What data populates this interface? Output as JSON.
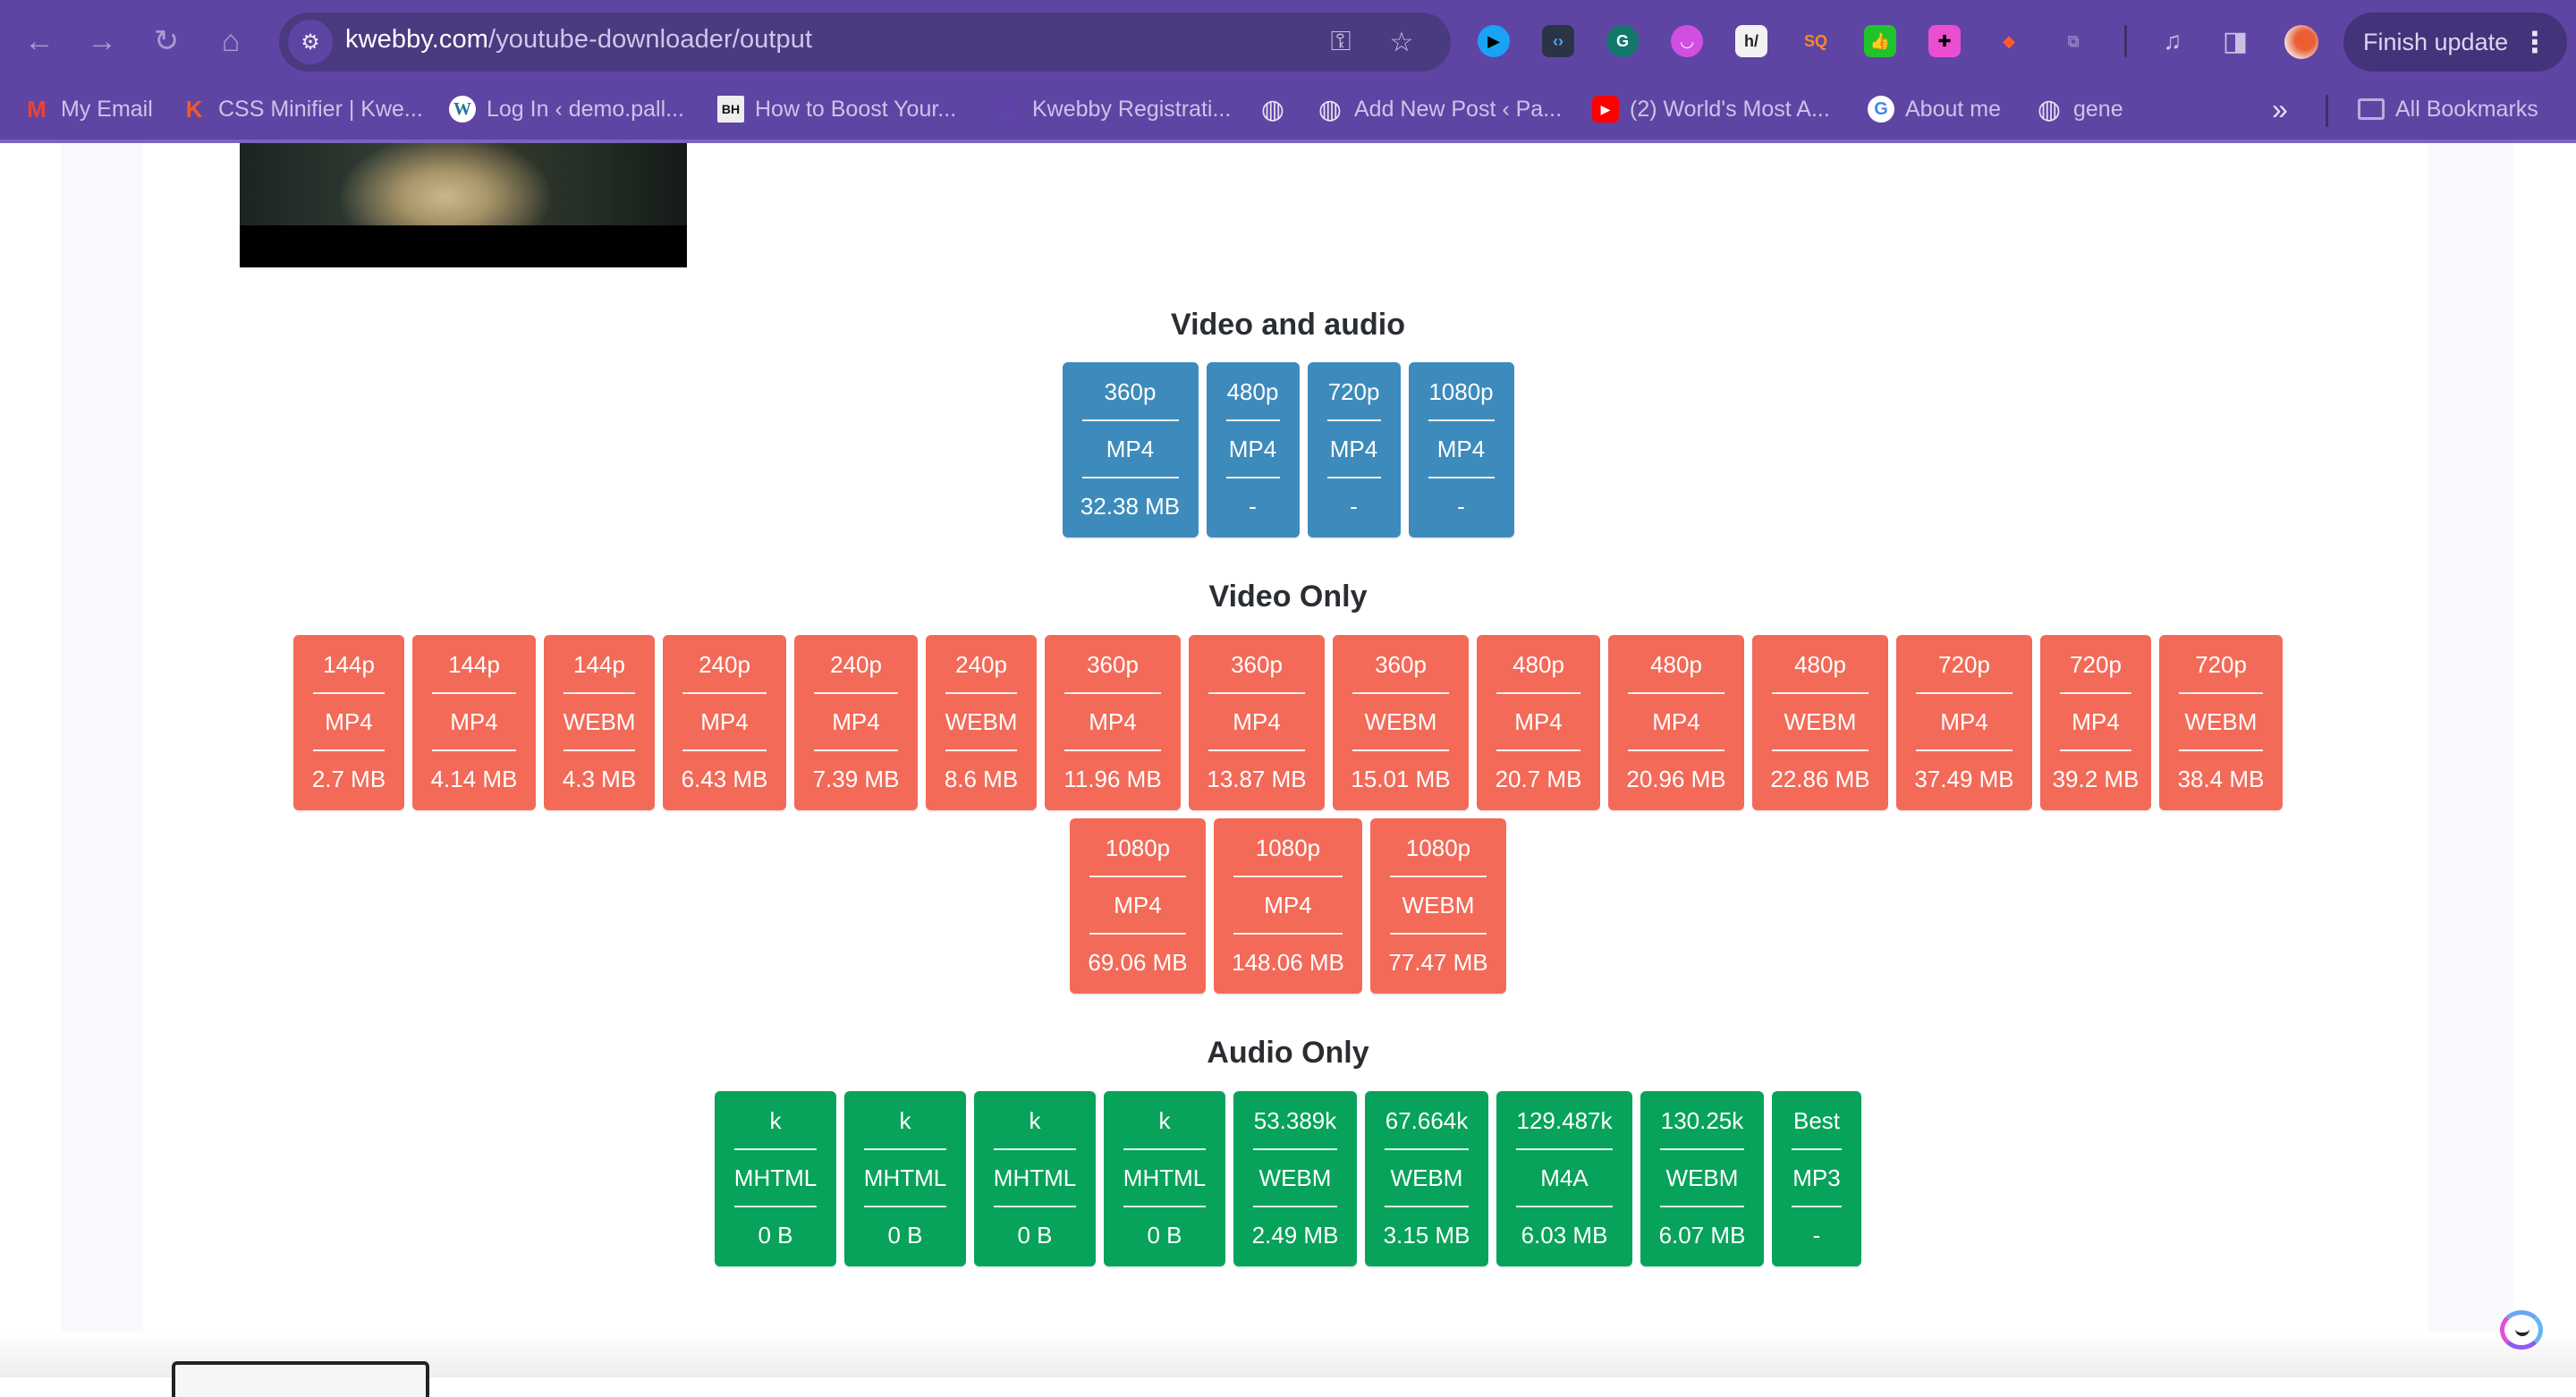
{
  "browser": {
    "url_host": "kwebby.com",
    "url_path": "/youtube-downloader/output",
    "finish_update_label": "Finish update",
    "nav": {
      "back": "←",
      "forward": "→",
      "reload": "↻",
      "home": "⌂"
    },
    "extensions": [
      {
        "name": "iq-extension-icon",
        "glyph": "▶",
        "bg": "#1aa3f5",
        "fg": "#000000"
      },
      {
        "name": "code-extension-icon",
        "glyph": "‹›",
        "bg": "#2b3445",
        "fg": "#4aa8f0"
      },
      {
        "name": "grammarly-icon",
        "glyph": "G",
        "bg": "#11786a",
        "fg": "#ffffff"
      },
      {
        "name": "jasper-icon",
        "glyph": "◡",
        "bg": "#d14fe0",
        "fg": "#ffffff"
      },
      {
        "name": "hackernoon-icon",
        "glyph": "h/",
        "bg": "#f2f2f2",
        "fg": "#222222"
      },
      {
        "name": "sq-extension-icon",
        "glyph": "SQ",
        "bg": "#5e45a4",
        "fg": "#ff8a1c"
      },
      {
        "name": "thumbs-up-extension-icon",
        "glyph": "👍",
        "bg": "#22c32a",
        "fg": "#ffffff"
      },
      {
        "name": "color-picker-icon",
        "glyph": "✚",
        "bg": "#e94fd0",
        "fg": "#000000"
      },
      {
        "name": "fox-extension-icon",
        "glyph": "◆",
        "bg": "#5e45a4",
        "fg": "#ff5a2a"
      },
      {
        "name": "extensions-puzzle-icon",
        "glyph": "⧉",
        "bg": "#5e45a4",
        "fg": "#8e7fc4"
      }
    ]
  },
  "bookmarks": [
    {
      "label": "My Email",
      "icon": "gmail-icon",
      "glyph": "M",
      "color": "#ea4335"
    },
    {
      "label": "CSS Minifier | Kwe...",
      "icon": "kwebby-icon",
      "glyph": "K",
      "color": "#f25a24"
    },
    {
      "label": "Log In ‹ demo.pall...",
      "icon": "wordpress-icon",
      "glyph": "W",
      "color": "#21759b"
    },
    {
      "label": "How to Boost Your...",
      "icon": "bh-icon",
      "glyph": "BH",
      "color": "#111111"
    },
    {
      "label": "Kwebby Registrati...",
      "icon": "forms-icon",
      "glyph": "☰",
      "color": "#673ab7"
    },
    {
      "label": "",
      "icon": "globe-icon",
      "glyph": "◍",
      "color": "#e8e4f3"
    },
    {
      "label": "Add New Post ‹ Pa...",
      "icon": "globe-icon",
      "glyph": "◍",
      "color": "#e8e4f3"
    },
    {
      "label": "(2) World's Most A...",
      "icon": "youtube-icon",
      "glyph": "▶",
      "color": "#ff0000"
    },
    {
      "label": "About me",
      "icon": "google-icon",
      "glyph": "G",
      "color": "#ffffff"
    },
    {
      "label": "gene",
      "icon": "globe-icon",
      "glyph": "◍",
      "color": "#e8e4f3"
    }
  ],
  "bookmarks_more": "»",
  "all_bookmarks_label": "All Bookmarks",
  "sections": {
    "video_audio": {
      "title": "Video and audio",
      "items": [
        {
          "quality": "360p",
          "format": "MP4",
          "size": "32.38 MB"
        },
        {
          "quality": "480p",
          "format": "MP4",
          "size": "-"
        },
        {
          "quality": "720p",
          "format": "MP4",
          "size": "-"
        },
        {
          "quality": "1080p",
          "format": "MP4",
          "size": "-"
        }
      ]
    },
    "video_only": {
      "title": "Video Only",
      "items": [
        {
          "quality": "144p",
          "format": "MP4",
          "size": "2.7 MB"
        },
        {
          "quality": "144p",
          "format": "MP4",
          "size": "4.14 MB"
        },
        {
          "quality": "144p",
          "format": "WEBM",
          "size": "4.3 MB"
        },
        {
          "quality": "240p",
          "format": "MP4",
          "size": "6.43 MB"
        },
        {
          "quality": "240p",
          "format": "MP4",
          "size": "7.39 MB"
        },
        {
          "quality": "240p",
          "format": "WEBM",
          "size": "8.6 MB"
        },
        {
          "quality": "360p",
          "format": "MP4",
          "size": "11.96 MB"
        },
        {
          "quality": "360p",
          "format": "MP4",
          "size": "13.87 MB"
        },
        {
          "quality": "360p",
          "format": "WEBM",
          "size": "15.01 MB"
        },
        {
          "quality": "480p",
          "format": "MP4",
          "size": "20.7 MB"
        },
        {
          "quality": "480p",
          "format": "MP4",
          "size": "20.96 MB"
        },
        {
          "quality": "480p",
          "format": "WEBM",
          "size": "22.86 MB"
        },
        {
          "quality": "720p",
          "format": "MP4",
          "size": "37.49 MB"
        },
        {
          "quality": "720p",
          "format": "MP4",
          "size": "39.2 MB"
        },
        {
          "quality": "720p",
          "format": "WEBM",
          "size": "38.4 MB"
        },
        {
          "quality": "1080p",
          "format": "MP4",
          "size": "69.06 MB"
        },
        {
          "quality": "1080p",
          "format": "MP4",
          "size": "148.06 MB"
        },
        {
          "quality": "1080p",
          "format": "WEBM",
          "size": "77.47 MB"
        }
      ]
    },
    "audio_only": {
      "title": "Audio Only",
      "items": [
        {
          "quality": "k",
          "format": "MHTML",
          "size": "0 B"
        },
        {
          "quality": "k",
          "format": "MHTML",
          "size": "0 B"
        },
        {
          "quality": "k",
          "format": "MHTML",
          "size": "0 B"
        },
        {
          "quality": "k",
          "format": "MHTML",
          "size": "0 B"
        },
        {
          "quality": "53.389k",
          "format": "WEBM",
          "size": "2.49 MB"
        },
        {
          "quality": "67.664k",
          "format": "WEBM",
          "size": "3.15 MB"
        },
        {
          "quality": "129.487k",
          "format": "M4A",
          "size": "6.03 MB"
        },
        {
          "quality": "130.25k",
          "format": "WEBM",
          "size": "6.07 MB"
        },
        {
          "quality": "Best",
          "format": "MP3",
          "size": "-"
        }
      ]
    }
  },
  "colors": {
    "chrome": "#5e45a4",
    "video_audio": "#3d8bbd",
    "video_only": "#f36a58",
    "audio_only": "#07a35a"
  }
}
